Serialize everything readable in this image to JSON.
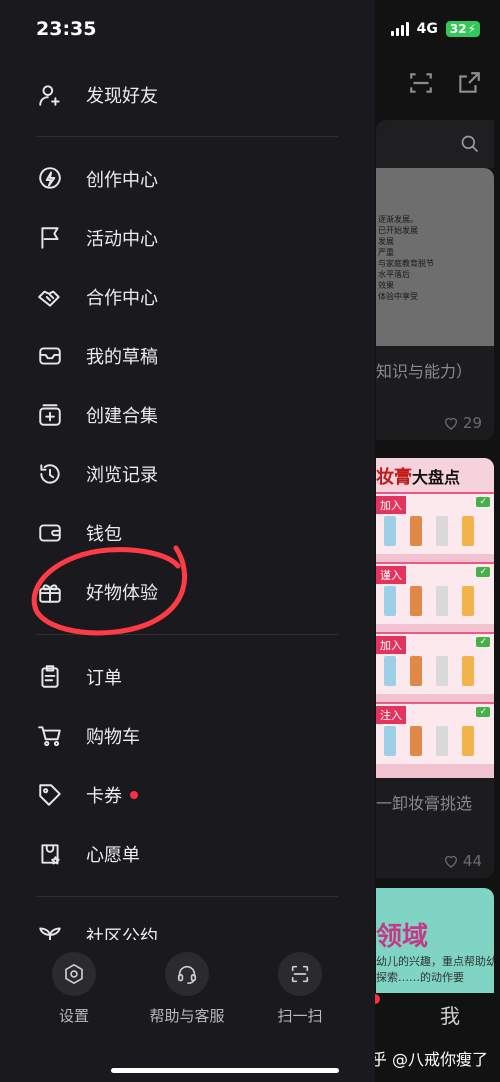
{
  "status_bar": {
    "time": "23:35",
    "network": "4G",
    "battery": "32"
  },
  "drawer": {
    "find_friends": "发现好友",
    "items_group1": [
      {
        "label": "创作中心",
        "icon": "bolt-icon"
      },
      {
        "label": "活动中心",
        "icon": "flag-icon"
      },
      {
        "label": "合作中心",
        "icon": "handshake-icon"
      },
      {
        "label": "我的草稿",
        "icon": "inbox-icon"
      },
      {
        "label": "创建合集",
        "icon": "add-collection-icon"
      },
      {
        "label": "浏览记录",
        "icon": "history-icon"
      },
      {
        "label": "钱包",
        "icon": "wallet-icon"
      },
      {
        "label": "好物体验",
        "icon": "gift-icon"
      }
    ],
    "items_group2": [
      {
        "label": "订单",
        "icon": "order-icon"
      },
      {
        "label": "购物车",
        "icon": "cart-icon"
      },
      {
        "label": "卡券",
        "icon": "coupon-icon",
        "has_red_dot": true
      },
      {
        "label": "心愿单",
        "icon": "wishlist-icon"
      }
    ],
    "community_label": "社区公约",
    "bottom_bar": {
      "settings": "设置",
      "help": "帮助与客服",
      "scan": "扫一扫"
    }
  },
  "background": {
    "card1_text_lines": [
      "逐渐发展。",
      "已开始发展",
      "发展",
      "",
      "严重",
      "与家庭教育脱节",
      "水平落后",
      "效果",
      "体验中享受"
    ],
    "card1_title": "知识与能力）",
    "card1_likes": "29",
    "card2_banner_red": "妆膏",
    "card2_banner_black": "大盘点",
    "card2_row_tags": [
      "加入",
      "谨入",
      "加入",
      "注入"
    ],
    "card2_title": "一卸妆膏挑选",
    "card2_likes": "44",
    "card3_title": "领域",
    "card3_lines": [
      "幼儿的兴趣，重点帮助幼儿发",
      "探索……的动作要"
    ],
    "tab_me": "我",
    "watermark": "知乎 @八戒你瘦了"
  },
  "colors": {
    "drawer_bg": "#1a1a1e",
    "accent_red": "#ff2d46",
    "annotation_red": "#ff3b46",
    "battery_green": "#34c759"
  }
}
